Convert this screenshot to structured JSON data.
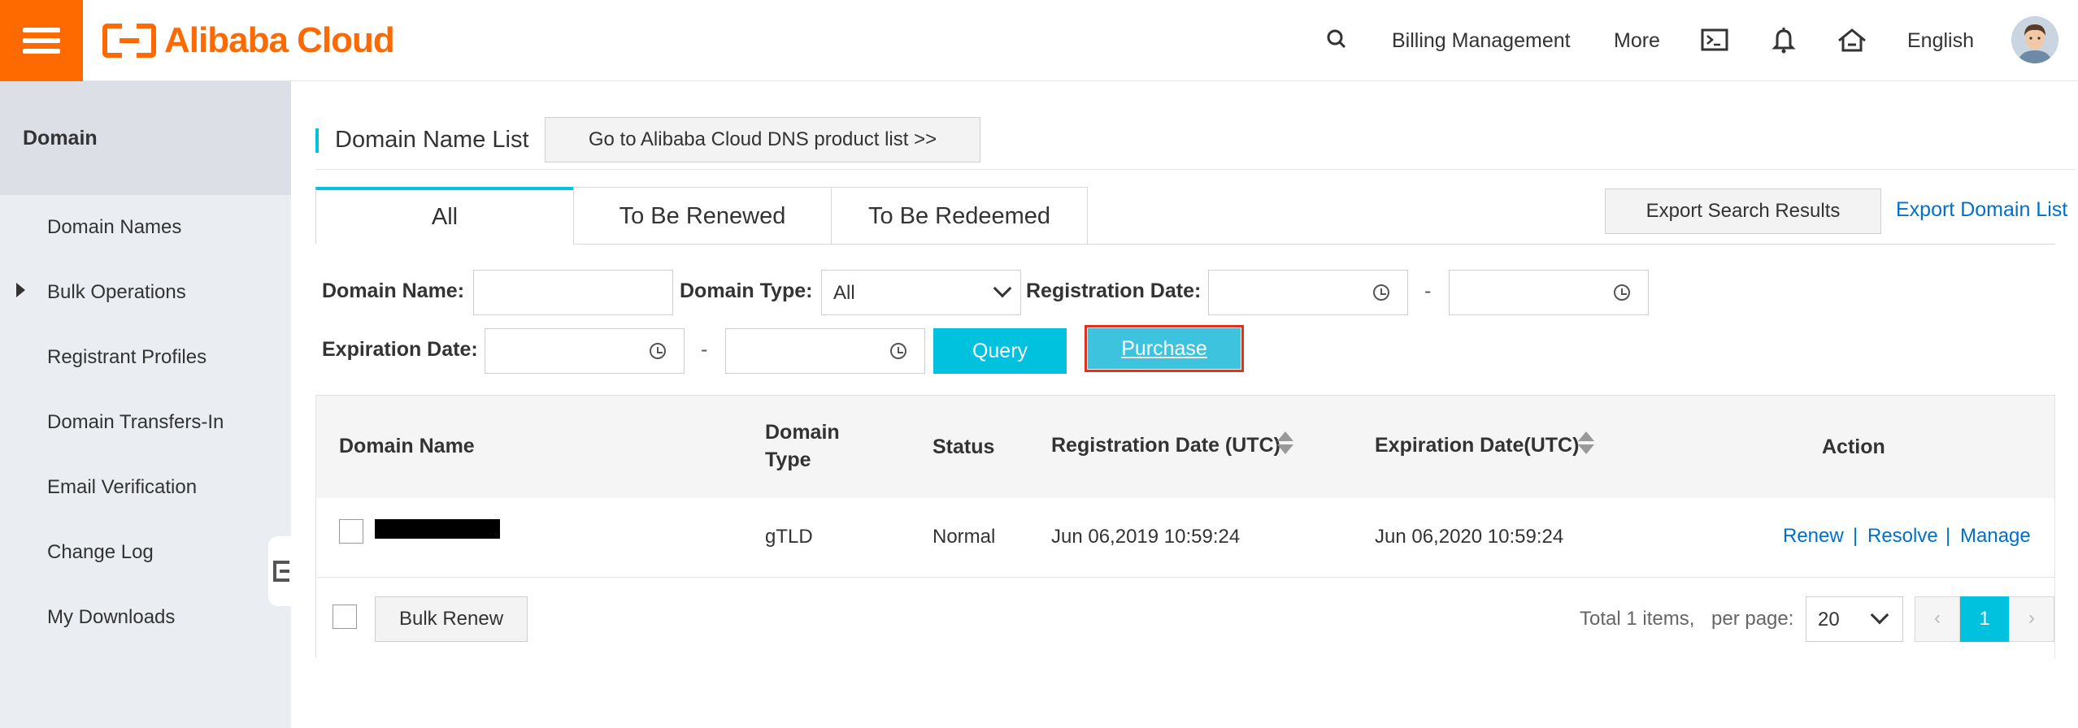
{
  "topbar": {
    "logo_text": "Alibaba Cloud",
    "billing": "Billing Management",
    "more": "More",
    "language": "English",
    "icons": [
      "menu-icon",
      "search-icon",
      "terminal-icon",
      "bell-icon",
      "home-icon",
      "avatar"
    ]
  },
  "sidebar": {
    "header": "Domain",
    "items": [
      {
        "label": "Domain Names"
      },
      {
        "label": "Bulk Operations"
      },
      {
        "label": "Registrant Profiles"
      },
      {
        "label": "Domain Transfers-In"
      },
      {
        "label": "Email Verification"
      },
      {
        "label": "Change Log"
      },
      {
        "label": "My Downloads"
      }
    ]
  },
  "main": {
    "title": "Domain Name List",
    "dns_button": "Go to Alibaba Cloud DNS product list >>",
    "tabs": [
      {
        "label": "All",
        "active": true
      },
      {
        "label": "To Be Renewed",
        "active": false
      },
      {
        "label": "To Be Redeemed",
        "active": false
      }
    ],
    "export_search": "Export Search Results",
    "export_list": "Export Domain List"
  },
  "filters": {
    "domain_name_label": "Domain Name:",
    "domain_name_value": "",
    "domain_type_label": "Domain Type:",
    "domain_type_value": "All",
    "registration_date_label": "Registration Date:",
    "expiration_date_label": "Expiration Date:",
    "range_sep": "-",
    "query": "Query",
    "purchase": "Purchase"
  },
  "table": {
    "headers": {
      "domain_name": "Domain Name",
      "domain_type_1": "Domain",
      "domain_type_2": "Type",
      "status": "Status",
      "registration": "Registration Date (UTC)",
      "expiration": "Expiration Date(UTC)",
      "action": "Action"
    },
    "rows": [
      {
        "domain_type": "gTLD",
        "status": "Normal",
        "registration": "Jun 06,2019 10:59:24",
        "expiration": "Jun 06,2020 10:59:24",
        "actions": [
          "Renew",
          "Resolve",
          "Manage"
        ]
      }
    ],
    "action_sep": "|",
    "bulk_renew": "Bulk Renew",
    "total": "Total 1 items,",
    "per_page_label": "per page:",
    "per_page_value": "20",
    "prev": "‹",
    "page": "1",
    "next": "›"
  },
  "colors": {
    "brand": "#ff6a00",
    "accent": "#00c1de",
    "link": "#0070cc",
    "highlight_border": "#e0301e"
  }
}
